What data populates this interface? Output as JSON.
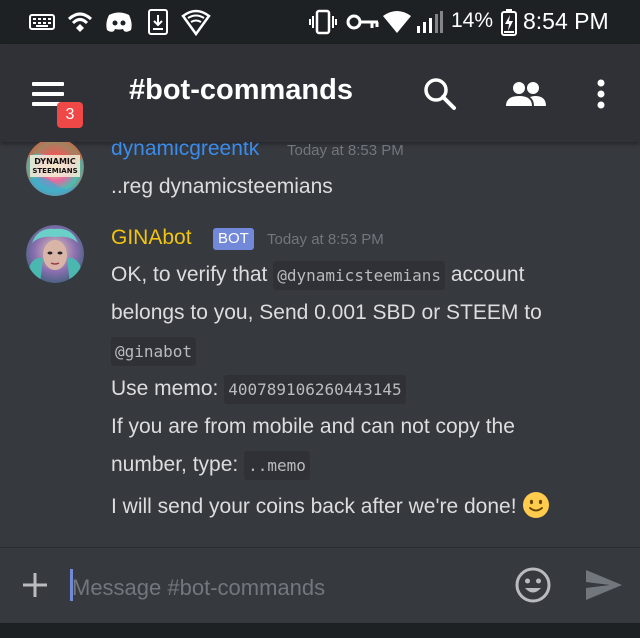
{
  "status_bar": {
    "battery_percent": "14%",
    "time": "8:54 PM",
    "icons": [
      "keyboard-icon",
      "wifi-calling-icon",
      "discord-icon",
      "download-icon",
      "shield-wifi-icon",
      "vibrate-icon",
      "key-icon",
      "wifi-icon",
      "signal-icon",
      "battery-charging-icon"
    ]
  },
  "app_bar": {
    "notification_count": "3",
    "channel_title": "#bot-commands",
    "icons": [
      "menu-icon",
      "search-icon",
      "members-icon",
      "more-vert-icon"
    ]
  },
  "messages": [
    {
      "author": "dynamicgreentk",
      "timestamp": "Today at 8:53 PM",
      "author_color": "#3b8beb",
      "avatar_text": "DYNAMIC STEEMIANS",
      "text": "..reg dynamicsteemians"
    },
    {
      "author": "GINAbot",
      "timestamp": "Today at 8:53 PM",
      "author_color": "#f1c40f",
      "bot_tag": "BOT",
      "line1_pre": "OK, to verify that",
      "line1_code": "@dynamicsteemians",
      "line1_post": "account",
      "line2": "belongs to you, Send 0.001 SBD or STEEM to",
      "line3_code": "@ginabot",
      "line4_pre": "Use memo:",
      "line4_code": "400789106260443145",
      "line5": "If you are from mobile and can not copy the",
      "line6_pre": "number, type:",
      "line6_code": "..memo",
      "line7": "I will send your coins back after we're done!",
      "emoji": "slightly-smiling-face-icon"
    }
  ],
  "input_bar": {
    "placeholder": "Message #bot-commands",
    "value": ""
  },
  "colors": {
    "background": "#36393e",
    "header": "#2f3136",
    "status_bar": "#1e2124",
    "accent": "#7289da",
    "badge": "#f04747"
  }
}
